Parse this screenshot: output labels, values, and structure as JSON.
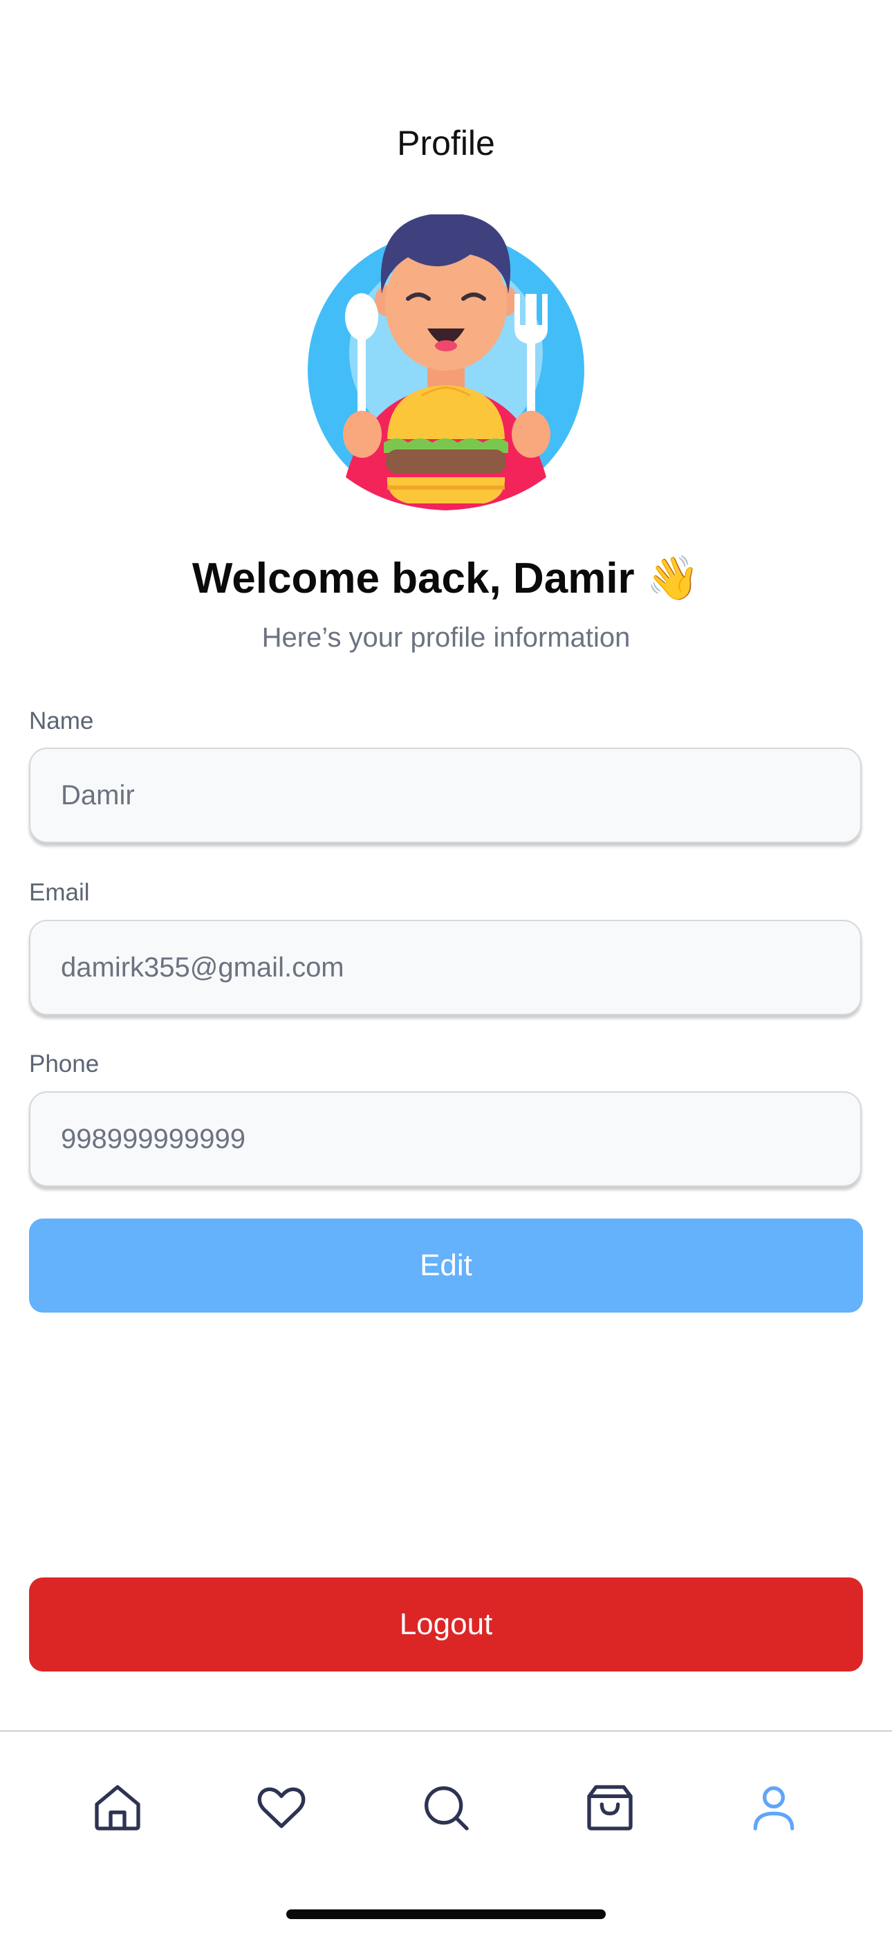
{
  "header": {
    "title": "Profile"
  },
  "profile": {
    "welcome": "Welcome back, Damir 👋",
    "subtitle": "Here’s your profile information"
  },
  "form": {
    "name": {
      "label": "Name",
      "value": "Damir"
    },
    "email": {
      "label": "Email",
      "value": "damirk355@gmail.com"
    },
    "phone": {
      "label": "Phone",
      "value": "998999999999"
    }
  },
  "actions": {
    "edit_label": "Edit",
    "logout_label": "Logout"
  },
  "tabbar": {
    "items": [
      {
        "icon": "home-icon",
        "active": false
      },
      {
        "icon": "heart-icon",
        "active": false
      },
      {
        "icon": "search-icon",
        "active": false
      },
      {
        "icon": "shopping-bag-icon",
        "active": false
      },
      {
        "icon": "user-icon",
        "active": true
      }
    ]
  },
  "colors": {
    "accent": "#64b1fc",
    "danger": "#dc2626",
    "tab_inactive": "#2d3352",
    "tab_active": "#60a5fa"
  }
}
